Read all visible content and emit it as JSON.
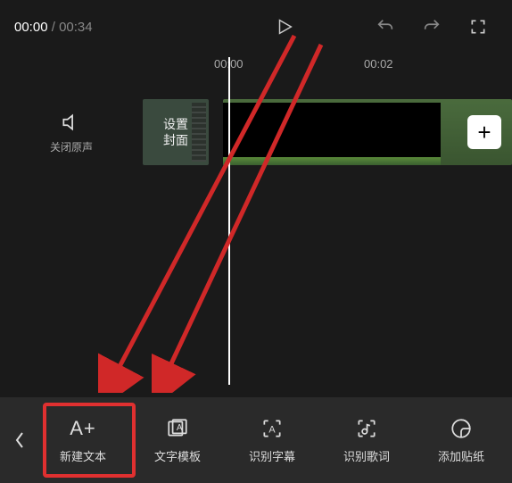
{
  "time": {
    "current": "00:00",
    "total": "00:34"
  },
  "ruler": {
    "t0": "00:00",
    "t1": "00:02"
  },
  "mute": {
    "label": "关闭原声"
  },
  "cover": {
    "label": "设置\n封面"
  },
  "add": {
    "symbol": "+"
  },
  "tools": {
    "back": "‹",
    "new_text": {
      "icon": "A+",
      "label": "新建文本"
    },
    "template": {
      "label": "文字模板"
    },
    "subtitle": {
      "label": "识别字幕"
    },
    "lyrics": {
      "label": "识别歌词"
    },
    "sticker": {
      "label": "添加贴纸"
    }
  }
}
